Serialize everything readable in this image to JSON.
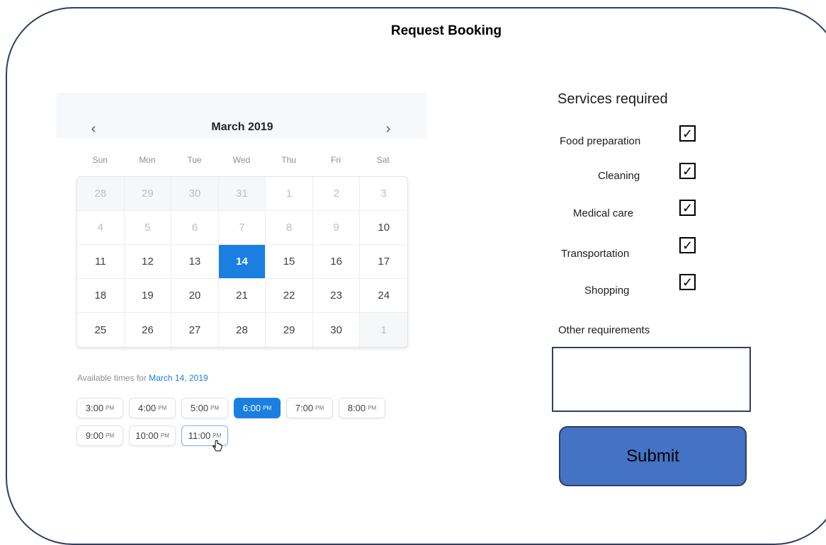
{
  "title": "Request Booking",
  "calendar": {
    "month_label": "March 2019",
    "prev_icon": "‹",
    "next_icon": "›",
    "weekdays": [
      "Sun",
      "Mon",
      "Tue",
      "Wed",
      "Thu",
      "Fri",
      "Sat"
    ],
    "days": [
      {
        "label": "28",
        "state": "muted-shade"
      },
      {
        "label": "29",
        "state": "muted-shade"
      },
      {
        "label": "30",
        "state": "muted-shade"
      },
      {
        "label": "31",
        "state": "muted-shade"
      },
      {
        "label": "1",
        "state": "muted"
      },
      {
        "label": "2",
        "state": "muted"
      },
      {
        "label": "3",
        "state": "muted"
      },
      {
        "label": "4",
        "state": "muted"
      },
      {
        "label": "5",
        "state": "muted"
      },
      {
        "label": "6",
        "state": "muted"
      },
      {
        "label": "7",
        "state": "muted"
      },
      {
        "label": "8",
        "state": "muted"
      },
      {
        "label": "9",
        "state": "muted"
      },
      {
        "label": "10",
        "state": "normal"
      },
      {
        "label": "11",
        "state": "normal"
      },
      {
        "label": "12",
        "state": "normal"
      },
      {
        "label": "13",
        "state": "normal"
      },
      {
        "label": "14",
        "state": "selected"
      },
      {
        "label": "15",
        "state": "normal"
      },
      {
        "label": "16",
        "state": "normal"
      },
      {
        "label": "17",
        "state": "normal"
      },
      {
        "label": "18",
        "state": "normal"
      },
      {
        "label": "19",
        "state": "normal"
      },
      {
        "label": "20",
        "state": "normal"
      },
      {
        "label": "21",
        "state": "normal"
      },
      {
        "label": "22",
        "state": "normal"
      },
      {
        "label": "23",
        "state": "normal"
      },
      {
        "label": "24",
        "state": "normal"
      },
      {
        "label": "25",
        "state": "normal"
      },
      {
        "label": "26",
        "state": "normal"
      },
      {
        "label": "27",
        "state": "normal"
      },
      {
        "label": "28",
        "state": "normal"
      },
      {
        "label": "29",
        "state": "normal"
      },
      {
        "label": "30",
        "state": "normal"
      },
      {
        "label": "1",
        "state": "muted-shade"
      }
    ],
    "accent_color": "#1a7fe0"
  },
  "times": {
    "label": "Available times for",
    "date": "March 14, 2019",
    "slots": [
      {
        "time": "3:00",
        "suffix": "PM",
        "state": "normal"
      },
      {
        "time": "4:00",
        "suffix": "PM",
        "state": "normal"
      },
      {
        "time": "5:00",
        "suffix": "PM",
        "state": "normal"
      },
      {
        "time": "6:00",
        "suffix": "PM",
        "state": "selected"
      },
      {
        "time": "7:00",
        "suffix": "PM",
        "state": "normal"
      },
      {
        "time": "8:00",
        "suffix": "PM",
        "state": "normal"
      },
      {
        "time": "9:00",
        "suffix": "PM",
        "state": "normal"
      },
      {
        "time": "10:00",
        "suffix": "PM",
        "state": "normal"
      },
      {
        "time": "11:00",
        "suffix": "PM",
        "state": "hover"
      }
    ],
    "cursor_icon": "hand-pointer-icon"
  },
  "services": {
    "title": "Services required",
    "items": [
      {
        "label": "Food preparation",
        "checked": true
      },
      {
        "label": "Cleaning",
        "checked": true
      },
      {
        "label": "Medical care",
        "checked": true
      },
      {
        "label": "Transportation",
        "checked": true
      },
      {
        "label": "Shopping",
        "checked": true
      }
    ],
    "check_glyph": "✓"
  },
  "other": {
    "label": "Other requirements",
    "value": ""
  },
  "submit_label": "Submit",
  "colors": {
    "frame": "#2f3e63",
    "submit_bg": "#4472c4"
  }
}
